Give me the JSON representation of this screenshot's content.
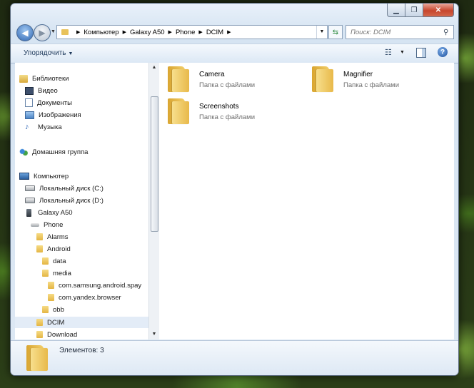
{
  "window": {
    "caption_buttons": [
      "minimize",
      "maximize",
      "close"
    ]
  },
  "address_bar": {
    "crumbs": [
      "Компьютер",
      "Galaxy A50",
      "Phone",
      "DCIM"
    ],
    "search_placeholder": "Поиск: DCIM"
  },
  "toolbar": {
    "organize_label": "Упорядочить"
  },
  "nav_pane": {
    "items": [
      {
        "label": "Библиотеки",
        "icon": "library-icon"
      },
      {
        "label": "Видео",
        "icon": "video-icon"
      },
      {
        "label": "Документы",
        "icon": "documents-icon"
      },
      {
        "label": "Изображения",
        "icon": "pictures-icon"
      },
      {
        "label": "Музыка",
        "icon": "music-icon"
      },
      {
        "label": "Домашняя группа",
        "icon": "homegroup-icon"
      },
      {
        "label": "Компьютер",
        "icon": "computer-icon"
      },
      {
        "label": "Локальный диск (C:)",
        "icon": "local-disk-icon"
      },
      {
        "label": "Локальный диск (D:)",
        "icon": "local-disk-icon"
      },
      {
        "label": "Galaxy A50",
        "icon": "phone-icon"
      },
      {
        "label": "Phone",
        "icon": "phone-storage-icon"
      },
      {
        "label": "Alarms",
        "icon": "folder-icon"
      },
      {
        "label": "Android",
        "icon": "folder-icon"
      },
      {
        "label": "data",
        "icon": "folder-icon"
      },
      {
        "label": "media",
        "icon": "folder-icon"
      },
      {
        "label": "com.samsung.android.spay",
        "icon": "folder-icon"
      },
      {
        "label": "com.yandex.browser",
        "icon": "folder-icon"
      },
      {
        "label": "obb",
        "icon": "folder-icon"
      },
      {
        "label": "DCIM",
        "icon": "folder-icon",
        "selected": true
      },
      {
        "label": "Download",
        "icon": "folder-icon"
      }
    ]
  },
  "content": {
    "folders": [
      {
        "name": "Camera",
        "type": "Папка с файлами"
      },
      {
        "name": "Magnifier",
        "type": "Папка с файлами"
      },
      {
        "name": "Screenshots",
        "type": "Папка с файлами"
      }
    ]
  },
  "details": {
    "count_text": "Элементов: 3"
  }
}
